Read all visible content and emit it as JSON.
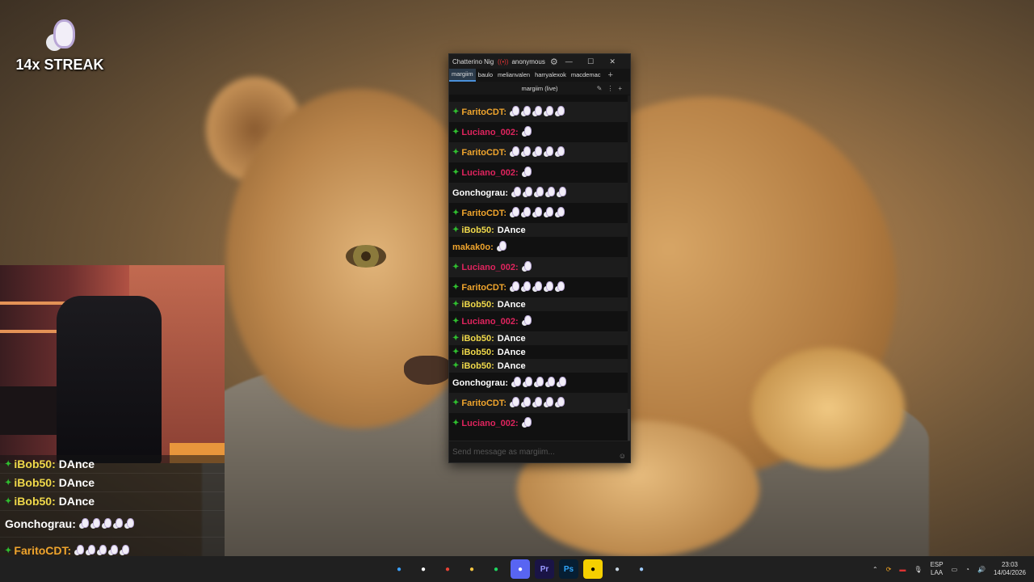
{
  "overlay": {
    "streak_text": "14x STREAK",
    "bottom_chat": [
      {
        "user": "iBob50:",
        "text": "DAnce",
        "color": "#f0d94a",
        "badge": true,
        "emotes": 0
      },
      {
        "user": "iBob50:",
        "text": "DAnce",
        "color": "#f0d94a",
        "badge": true,
        "emotes": 0
      },
      {
        "user": "iBob50:",
        "text": "DAnce",
        "color": "#f0d94a",
        "badge": true,
        "emotes": 0
      },
      {
        "user": "Gonchograu:",
        "text": "",
        "color": "#ffffff",
        "badge": false,
        "emotes": 5
      },
      {
        "user": "FaritoCDT:",
        "text": "",
        "color": "#f0a52d",
        "badge": true,
        "emotes": 5
      },
      {
        "user": "Luciano_002:",
        "text": "",
        "color": "#e0245e",
        "badge": true,
        "emotes": 1
      }
    ]
  },
  "chatterino": {
    "title": "Chatterino Nig",
    "user": "anonymous",
    "tabs": [
      "margiim",
      "baulo",
      "melianvalen",
      "harryalexok",
      "macdemac"
    ],
    "active_tab": "margiim",
    "add_tab": "+",
    "channel": "margiim (live)",
    "input_placeholder": "Send message as margiim...",
    "messages": [
      {
        "user": "FaritoCDT:",
        "text": "",
        "color": "#f0a52d",
        "badge": true,
        "emotes": 5,
        "tall": true
      },
      {
        "user": "Luciano_002:",
        "text": "",
        "color": "#e0245e",
        "badge": true,
        "emotes": 1,
        "tall": true
      },
      {
        "user": "FaritoCDT:",
        "text": "",
        "color": "#f0a52d",
        "badge": true,
        "emotes": 5,
        "tall": true
      },
      {
        "user": "Luciano_002:",
        "text": "",
        "color": "#e0245e",
        "badge": true,
        "emotes": 1,
        "tall": true
      },
      {
        "user": "Gonchograu:",
        "text": "",
        "color": "#ffffff",
        "badge": false,
        "emotes": 5,
        "tall": true
      },
      {
        "user": "FaritoCDT:",
        "text": "",
        "color": "#f0a52d",
        "badge": true,
        "emotes": 5,
        "tall": true
      },
      {
        "user": "iBob50:",
        "text": "DAnce",
        "color": "#f0d94a",
        "badge": true,
        "emotes": 0,
        "tall": false
      },
      {
        "user": "makak0o:",
        "text": "",
        "color": "#f0a52d",
        "badge": false,
        "emotes": 1,
        "tall": true
      },
      {
        "user": "Luciano_002:",
        "text": "",
        "color": "#e0245e",
        "badge": true,
        "emotes": 1,
        "tall": true
      },
      {
        "user": "FaritoCDT:",
        "text": "",
        "color": "#f0a52d",
        "badge": true,
        "emotes": 5,
        "tall": true
      },
      {
        "user": "iBob50:",
        "text": "DAnce",
        "color": "#f0d94a",
        "badge": true,
        "emotes": 0,
        "tall": false
      },
      {
        "user": "Luciano_002:",
        "text": "",
        "color": "#e0245e",
        "badge": true,
        "emotes": 1,
        "tall": true
      },
      {
        "user": "iBob50:",
        "text": "DAnce",
        "color": "#f0d94a",
        "badge": true,
        "emotes": 0,
        "tall": false
      },
      {
        "user": "iBob50:",
        "text": "DAnce",
        "color": "#f0d94a",
        "badge": true,
        "emotes": 0,
        "tall": false
      },
      {
        "user": "iBob50:",
        "text": "DAnce",
        "color": "#f0d94a",
        "badge": true,
        "emotes": 0,
        "tall": false
      },
      {
        "user": "Gonchograu:",
        "text": "",
        "color": "#ffffff",
        "badge": false,
        "emotes": 5,
        "tall": true
      },
      {
        "user": "FaritoCDT:",
        "text": "",
        "color": "#f0a52d",
        "badge": true,
        "emotes": 5,
        "tall": true
      },
      {
        "user": "Luciano_002:",
        "text": "",
        "color": "#e0245e",
        "badge": true,
        "emotes": 1,
        "tall": true
      }
    ]
  },
  "taskbar": {
    "apps": [
      {
        "name": "windows-start-icon",
        "label": "",
        "bg": "#202020",
        "color": "#3aa0ff"
      },
      {
        "name": "obs-icon",
        "label": "",
        "bg": "#202020",
        "color": "#ffffff"
      },
      {
        "name": "chrome-icon",
        "label": "",
        "bg": "#202020",
        "color": "#e94235"
      },
      {
        "name": "file-explorer-icon",
        "label": "",
        "bg": "#202020",
        "color": "#f5c542"
      },
      {
        "name": "spotify-icon",
        "label": "",
        "bg": "#202020",
        "color": "#1ed760"
      },
      {
        "name": "discord-icon",
        "label": "",
        "bg": "#5865f2",
        "color": "#ffffff"
      },
      {
        "name": "premiere-icon",
        "label": "Pr",
        "bg": "#1a1446",
        "color": "#9999ff"
      },
      {
        "name": "photoshop-icon",
        "label": "Ps",
        "bg": "#061e33",
        "color": "#31a8ff"
      },
      {
        "name": "sticky-notes-icon",
        "label": "",
        "bg": "#f5d000",
        "color": "#000000"
      },
      {
        "name": "steam-icon",
        "label": "",
        "bg": "#202020",
        "color": "#c7d5e0"
      },
      {
        "name": "chatterino-icon",
        "label": "",
        "bg": "#202020",
        "color": "#9ecbff"
      }
    ],
    "language_top": "ESP",
    "language_bottom": "LAA",
    "time": "23:03",
    "date": "14/04/2026"
  }
}
